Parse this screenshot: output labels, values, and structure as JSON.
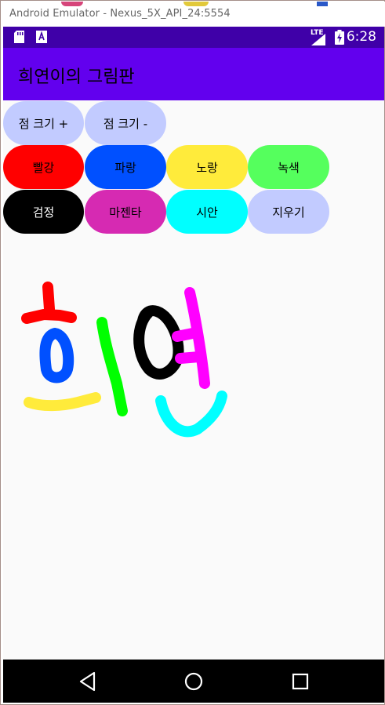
{
  "window": {
    "title": "Android Emulator - Nexus_5X_API_24:5554"
  },
  "status_bar": {
    "time": "6:28",
    "network": "LTE"
  },
  "app": {
    "title": "희연이의 그림판"
  },
  "size_buttons": [
    {
      "label": "점 크기 +",
      "color": "#c2cbff"
    },
    {
      "label": "점 크기 -",
      "color": "#c2cbff"
    }
  ],
  "color_buttons_row1": [
    {
      "label": "빨강",
      "color": "#ff0000"
    },
    {
      "label": "파랑",
      "color": "#0050ff"
    },
    {
      "label": "노랑",
      "color": "#ffeb3b"
    },
    {
      "label": "녹색",
      "color": "#55ff5d"
    }
  ],
  "color_buttons_row2": [
    {
      "label": "검정",
      "color": "#000000"
    },
    {
      "label": "마젠타",
      "color": "#d62ab2"
    },
    {
      "label": "시안",
      "color": "#00ffff"
    },
    {
      "label": "지우기",
      "color": "#c2cbff"
    }
  ],
  "drawing": {
    "content": "hand-drawn strokes (spelling 희연) in red, blue, yellow, green, black, magenta and cyan"
  },
  "nav_icons": [
    "back-icon",
    "home-icon",
    "recents-icon"
  ]
}
